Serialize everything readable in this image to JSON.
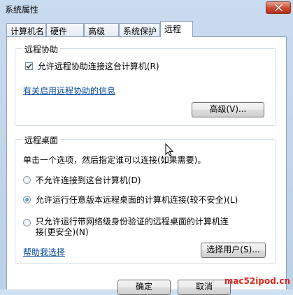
{
  "window": {
    "title": "系统属性"
  },
  "tabs": [
    {
      "label": "计算机名",
      "active": false
    },
    {
      "label": "硬件",
      "active": false
    },
    {
      "label": "高级",
      "active": false
    },
    {
      "label": "系统保护",
      "active": false
    },
    {
      "label": "远程",
      "active": true
    }
  ],
  "remote_assistance": {
    "title": "远程协助",
    "allow_checkbox_label": "允许远程协助连接这台计算机(R)",
    "allow_checked": true,
    "info_link": "有关启用远程协助的信息",
    "advanced_button": "高级(V)..."
  },
  "remote_desktop": {
    "title": "远程桌面",
    "instruction": "单击一个选项，然后指定谁可以连接(如果需要)。",
    "options": [
      {
        "label": "不允许连接到这台计算机(D)",
        "selected": false
      },
      {
        "label": "允许运行任意版本远程桌面的计算机连接(较不安全)(L)",
        "selected": true
      },
      {
        "label": "只允许运行带网络级身份验证的远程桌面的计算机连",
        "label_line2": "接(更安全)(N)",
        "selected": false
      }
    ],
    "help_link": "帮助我选择",
    "select_users_button": "选择用户(S)..."
  },
  "footer": {
    "ok_button": "确定",
    "cancel_button": "取消"
  },
  "watermark": "mac52ipod.cn",
  "colors": {
    "link": "#0a4ca0",
    "selection_accent": "#1a5fb4",
    "watermark": "#d6281e"
  }
}
